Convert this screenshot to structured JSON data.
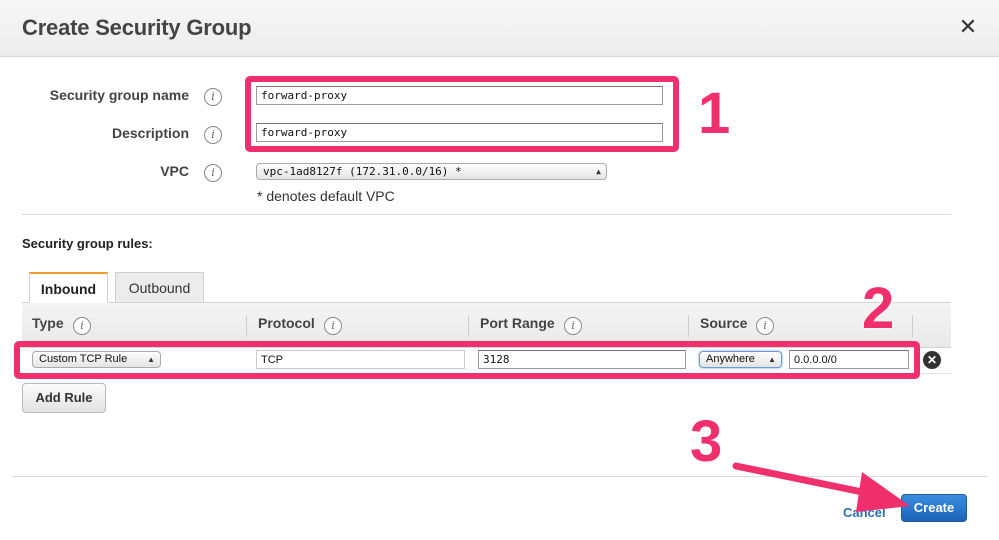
{
  "dialog": {
    "title": "Create Security Group",
    "close_glyph": "✕"
  },
  "form": {
    "name_label": "Security group name",
    "name_value": "forward-proxy",
    "description_label": "Description",
    "description_value": "forward-proxy",
    "vpc_label": "VPC",
    "vpc_value": "vpc-1ad8127f (172.31.0.0/16) *",
    "vpc_hint": "* denotes default VPC",
    "info_glyph": "i"
  },
  "rules": {
    "title": "Security group rules:",
    "tabs": [
      {
        "label": "Inbound",
        "active": true
      },
      {
        "label": "Outbound",
        "active": false
      }
    ],
    "columns": [
      "Type",
      "Protocol",
      "Port Range",
      "Source"
    ],
    "row": {
      "type": "Custom TCP Rule",
      "protocol": "TCP",
      "port_range": "3128",
      "source_select": "Anywhere",
      "source_cidr": "0.0.0.0/0"
    },
    "add_rule_label": "Add Rule"
  },
  "footer": {
    "cancel_label": "Cancel",
    "create_label": "Create"
  },
  "annotations": {
    "n1": "1",
    "n2": "2",
    "n3": "3"
  },
  "colors": {
    "highlight": "#f0306c",
    "primary": "#1c63b7",
    "tab_accent": "#f59d2b"
  },
  "icons": {
    "info": "info-icon",
    "close": "close-icon",
    "remove": "remove-rule-icon",
    "select": "select-arrows-icon"
  }
}
